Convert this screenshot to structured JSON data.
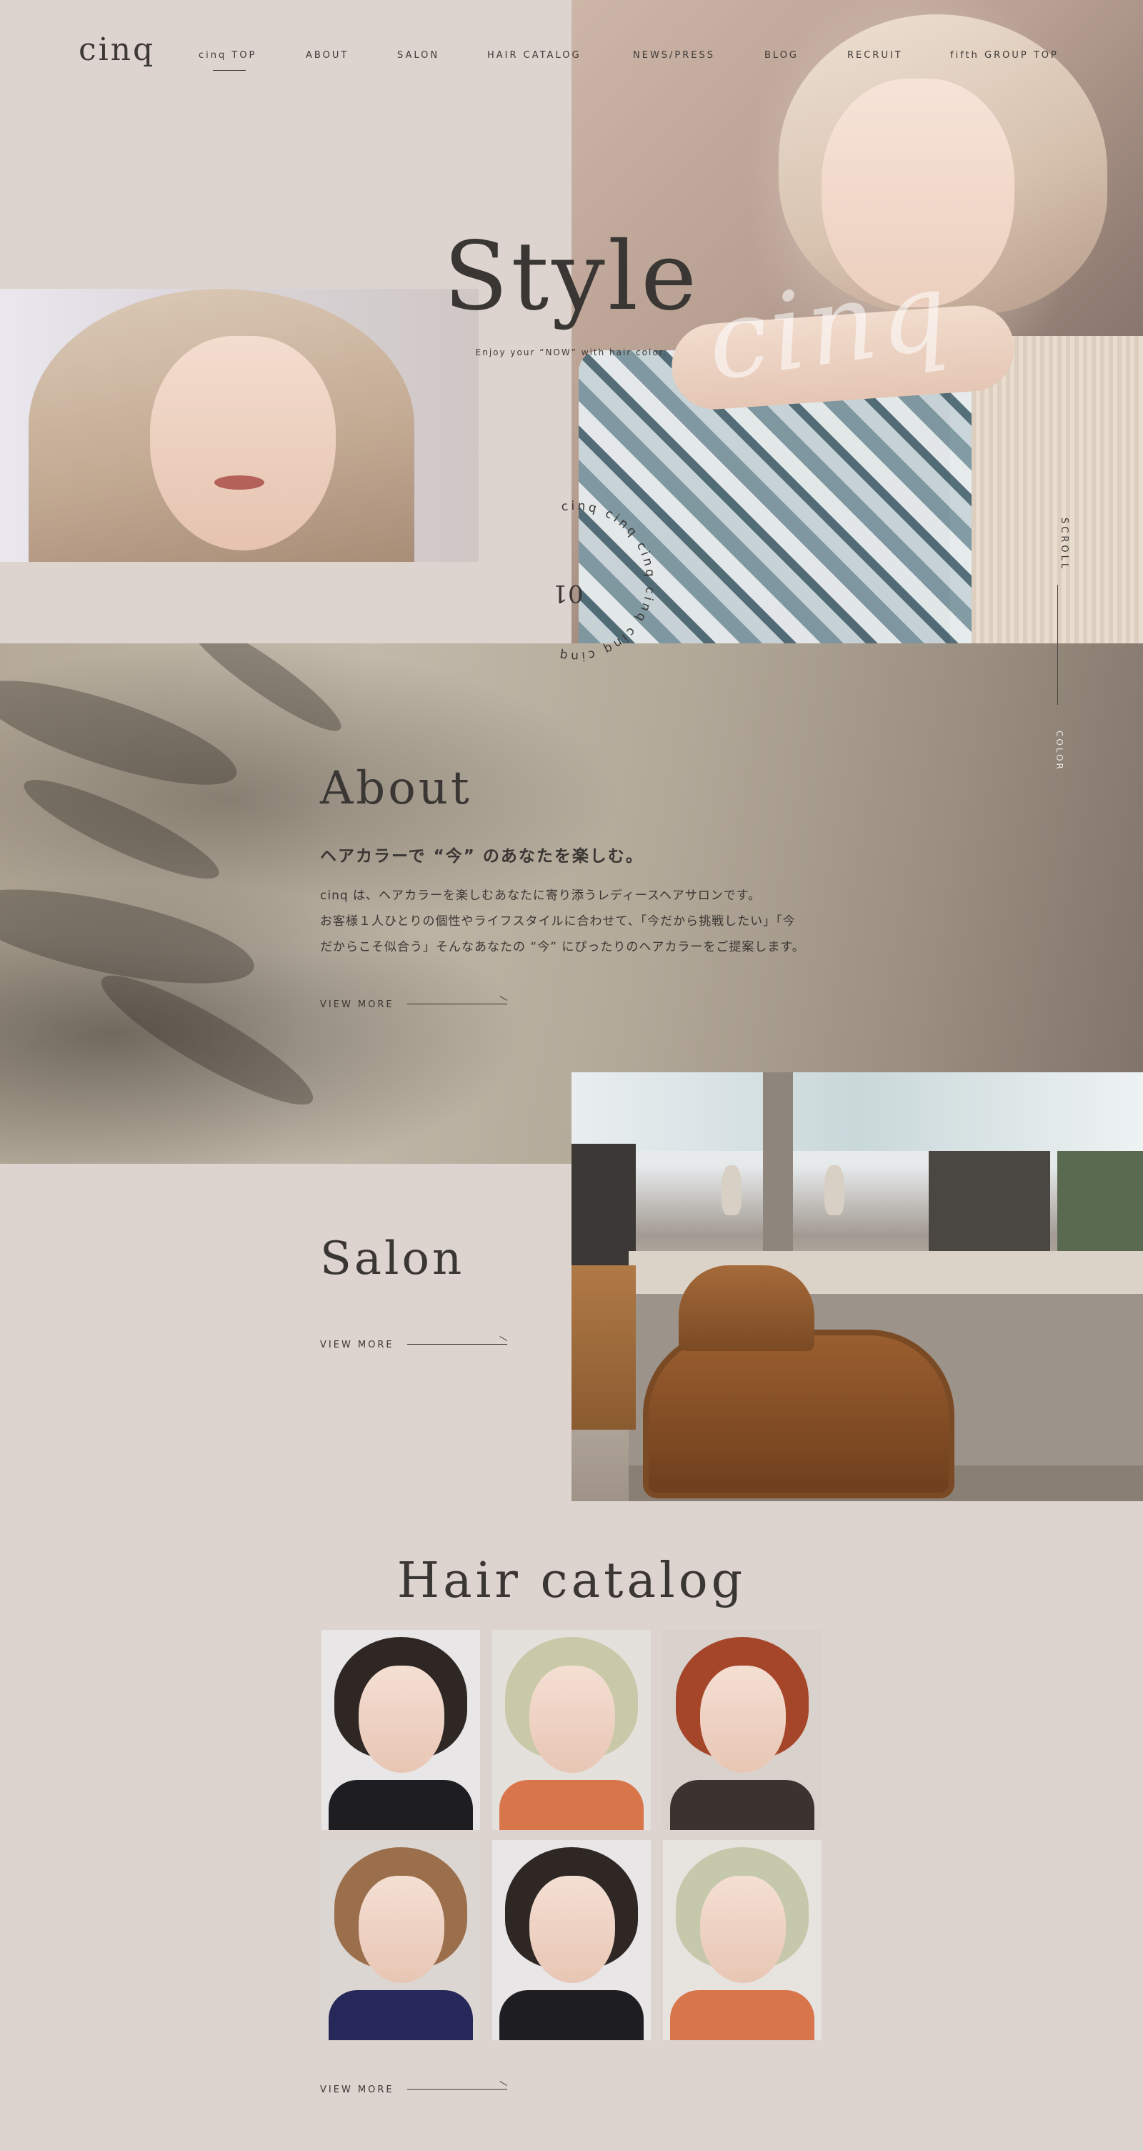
{
  "brand": {
    "logo": "cinq"
  },
  "nav": {
    "items": [
      {
        "label": "cinq TOP"
      },
      {
        "label": "ABOUT"
      },
      {
        "label": "SALON"
      },
      {
        "label": "HAIR CATALOG"
      },
      {
        "label": "NEWS/PRESS"
      },
      {
        "label": "BLOG"
      },
      {
        "label": "RECRUIT"
      },
      {
        "label": "fifth GROUP TOP"
      }
    ],
    "active": "cinq TOP"
  },
  "hero": {
    "title": "Style",
    "subtitle": "Enjoy your “NOW” with hair color.",
    "script_text": "cinq",
    "circle_text": "cinq cinq cinq cinq cinq cinq",
    "number": "01",
    "scroll_label": "SCROLL",
    "color_label": "COLOR"
  },
  "about": {
    "title": "About",
    "heading": "ヘアカラーで “今” のあなたを楽しむ。",
    "body_lines": [
      "cinq は、ヘアカラーを楽しむあなたに寄り添うレディースヘアサロンです。",
      "お客様１人ひとりの個性やライフスタイルに合わせて、「今だから挑戦したい」「今",
      "だからこそ似合う」そんなあなたの “今” にぴったりのヘアカラーをご提案します。"
    ],
    "view_more": "VIEW MORE"
  },
  "salon": {
    "title": "Salon",
    "view_more": "VIEW MORE"
  },
  "hair_catalog": {
    "title": "Hair catalog",
    "view_more": "VIEW MORE",
    "items": [
      {
        "hair": "#2e2724",
        "body": "#1e1e22",
        "bg": "#e8e6e6"
      },
      {
        "hair": "#c9c8a8",
        "body": "#d9754a",
        "bg": "#e4e0dc"
      },
      {
        "hair": "#a5462a",
        "body": "#3a3330",
        "bg": "#d9d2cc"
      },
      {
        "hair": "#9c6f4c",
        "body": "#26285a",
        "bg": "#dcd6d3"
      },
      {
        "hair": "#2e2724",
        "body": "#1e1e22",
        "bg": "#e8e6e6"
      },
      {
        "hair": "#c5c8aa",
        "body": "#d9754a",
        "bg": "#e7e3df"
      }
    ]
  },
  "colors": {
    "background": "#ddd4cf",
    "text": "#3a3633",
    "about_bg": "#b5aa99"
  }
}
